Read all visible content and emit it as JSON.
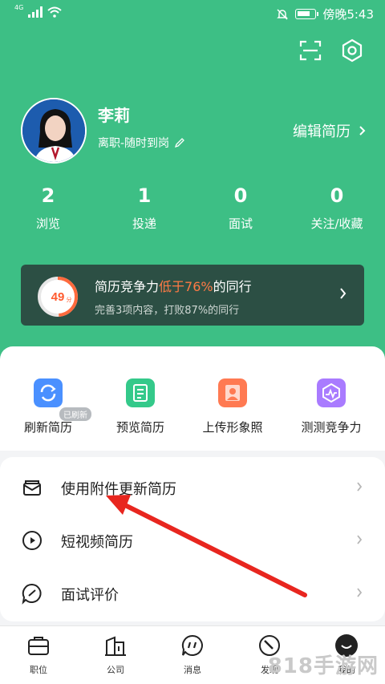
{
  "statusbar": {
    "network": "4G",
    "time": "傍晚5:43"
  },
  "header": {
    "scan_icon": "scan-icon",
    "settings_icon": "settings-icon"
  },
  "profile": {
    "name": "李莉",
    "status": "离职-随时到岗",
    "edit_resume": "编辑简历"
  },
  "stats": [
    {
      "value": "2",
      "label": "浏览"
    },
    {
      "value": "1",
      "label": "投递"
    },
    {
      "value": "0",
      "label": "面试"
    },
    {
      "value": "0",
      "label": "关注/收藏"
    }
  ],
  "competitiveness": {
    "score": "49",
    "score_unit": "分",
    "score_fraction": 0.49,
    "text_prefix": "简历竞争力",
    "text_highlight": "低于76%",
    "text_suffix": "的同行",
    "subtext": "完善3项内容，打败87%的同行"
  },
  "tools": [
    {
      "label": "刷新简历",
      "badge": "已刷新",
      "icon": "refresh-icon",
      "color": "#4a90ff"
    },
    {
      "label": "预览简历",
      "icon": "document-icon",
      "color": "#34c98a"
    },
    {
      "label": "上传形象照",
      "icon": "portrait-icon",
      "color": "#ff7a52"
    },
    {
      "label": "测测竞争力",
      "icon": "chart-icon",
      "color": "#a97bff"
    }
  ],
  "menu": [
    {
      "label": "使用附件更新简历",
      "icon": "envelope-icon"
    },
    {
      "label": "短视频简历",
      "icon": "play-icon"
    },
    {
      "label": "面试评价",
      "icon": "comment-icon"
    }
  ],
  "tabbar": [
    {
      "label": "职位",
      "icon": "briefcase-icon"
    },
    {
      "label": "公司",
      "icon": "building-icon"
    },
    {
      "label": "消息",
      "icon": "message-icon"
    },
    {
      "label": "发现",
      "icon": "compass-icon"
    },
    {
      "label": "我的",
      "icon": "profile-icon"
    }
  ],
  "watermark": "818手游网"
}
